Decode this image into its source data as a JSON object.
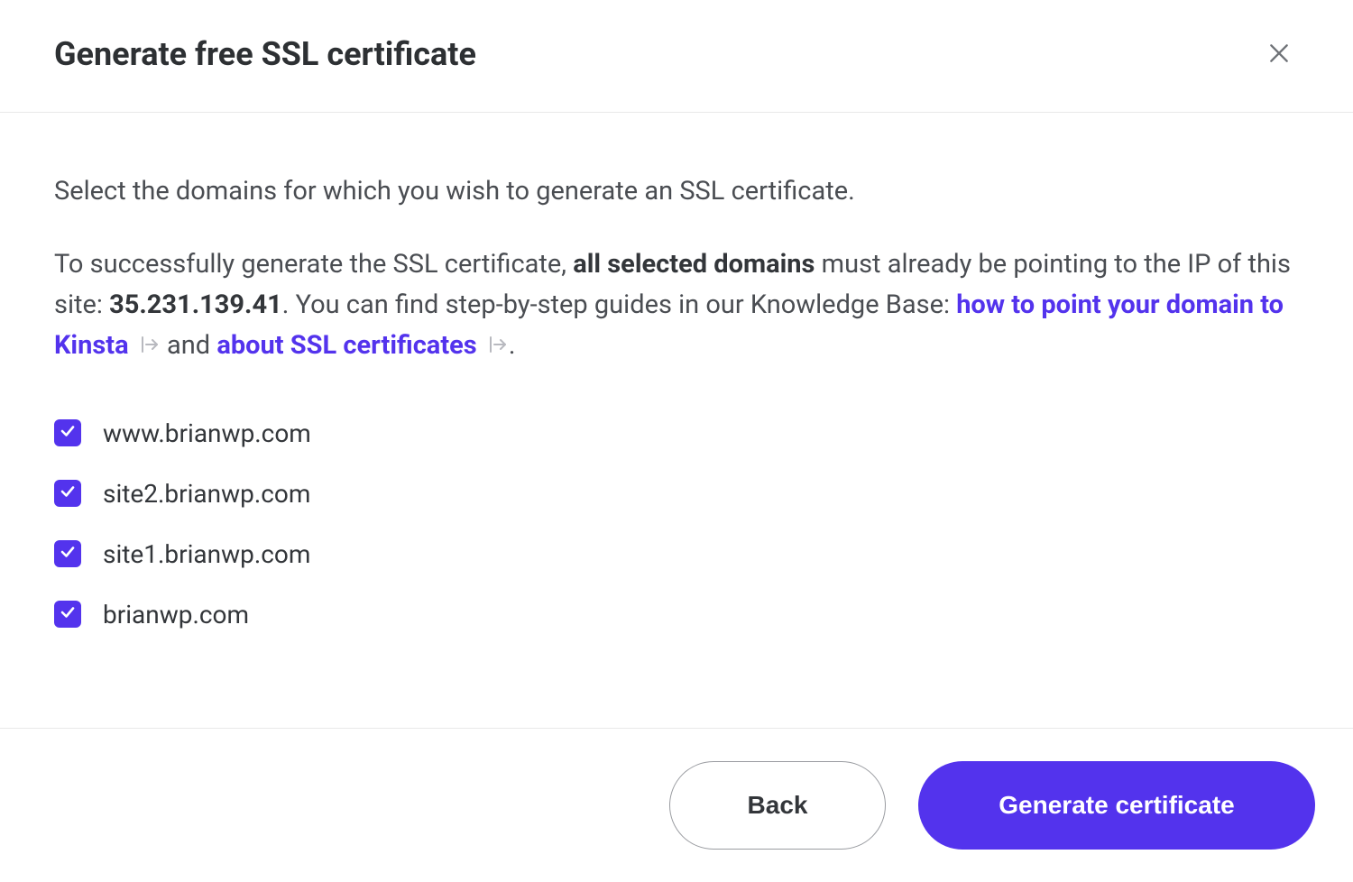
{
  "header": {
    "title": "Generate free SSL certificate"
  },
  "body": {
    "intro": "Select the domains for which you wish to generate an SSL certificate.",
    "help_text_1": "To successfully generate the SSL certificate, ",
    "help_bold": "all selected domains",
    "help_text_2": " must already be pointing to the IP of this site: ",
    "ip": "35.231.139.41",
    "help_text_3": ". You can find step-by-step guides in our Knowledge Base: ",
    "link1": "how to point your domain to Kinsta",
    "link_sep": " and ",
    "link2": "about SSL certificates",
    "help_text_end": "."
  },
  "domains": [
    {
      "label": "www.brianwp.com",
      "checked": true
    },
    {
      "label": "site2.brianwp.com",
      "checked": true
    },
    {
      "label": "site1.brianwp.com",
      "checked": true
    },
    {
      "label": "brianwp.com",
      "checked": true
    }
  ],
  "footer": {
    "back": "Back",
    "generate": "Generate certificate"
  }
}
